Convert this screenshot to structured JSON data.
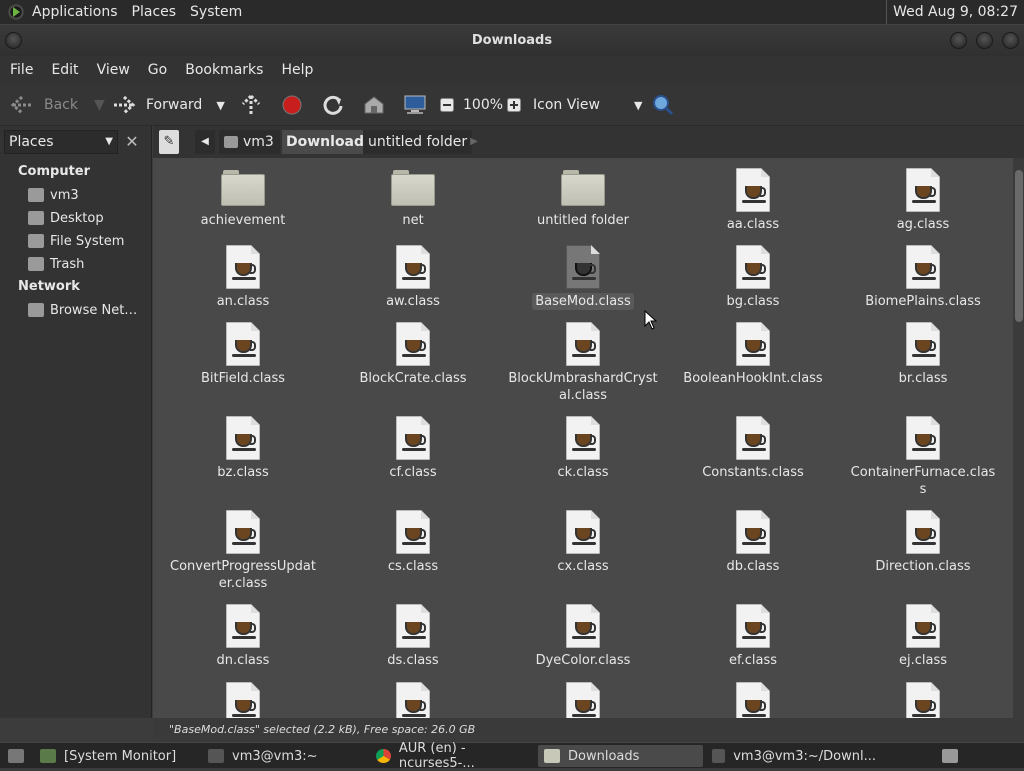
{
  "topbar": {
    "menus": [
      "Applications",
      "Places",
      "System"
    ],
    "clock": "Wed Aug  9, 08:27"
  },
  "window": {
    "title": "Downloads"
  },
  "menubar": [
    "File",
    "Edit",
    "View",
    "Go",
    "Bookmarks",
    "Help"
  ],
  "toolbar": {
    "back": "Back",
    "forward": "Forward",
    "zoom": "100%",
    "view_mode": "Icon View"
  },
  "sidebar": {
    "header": "Places",
    "sections": [
      {
        "title": "Computer",
        "items": [
          "vm3",
          "Desktop",
          "File System",
          "Trash"
        ]
      },
      {
        "title": "Network",
        "items": [
          "Browse Net…"
        ]
      }
    ]
  },
  "pathbar": {
    "crumbs": [
      "vm3",
      "Downloads",
      "untitled folder"
    ]
  },
  "items": [
    {
      "name": "achievement",
      "type": "folder"
    },
    {
      "name": "net",
      "type": "folder"
    },
    {
      "name": "untitled folder",
      "type": "folder"
    },
    {
      "name": "aa.class",
      "type": "file"
    },
    {
      "name": "ag.class",
      "type": "file"
    },
    {
      "name": "an.class",
      "type": "file"
    },
    {
      "name": "aw.class",
      "type": "file"
    },
    {
      "name": "BaseMod.class",
      "type": "file",
      "selected": true
    },
    {
      "name": "bg.class",
      "type": "file"
    },
    {
      "name": "BiomePlains.class",
      "type": "file"
    },
    {
      "name": "BitField.class",
      "type": "file"
    },
    {
      "name": "BlockCrate.class",
      "type": "file"
    },
    {
      "name": "BlockUmbrashardCrystal.class",
      "type": "file"
    },
    {
      "name": "BooleanHookInt.class",
      "type": "file"
    },
    {
      "name": "br.class",
      "type": "file"
    },
    {
      "name": "bz.class",
      "type": "file"
    },
    {
      "name": "cf.class",
      "type": "file"
    },
    {
      "name": "ck.class",
      "type": "file"
    },
    {
      "name": "Constants.class",
      "type": "file"
    },
    {
      "name": "ContainerFurnace.class",
      "type": "file"
    },
    {
      "name": "ConvertProgressUpdater.class",
      "type": "file"
    },
    {
      "name": "cs.class",
      "type": "file"
    },
    {
      "name": "cx.class",
      "type": "file"
    },
    {
      "name": "db.class",
      "type": "file"
    },
    {
      "name": "Direction.class",
      "type": "file"
    },
    {
      "name": "dn.class",
      "type": "file"
    },
    {
      "name": "ds.class",
      "type": "file"
    },
    {
      "name": "DyeColor.class",
      "type": "file"
    },
    {
      "name": "ef.class",
      "type": "file"
    },
    {
      "name": "ej.class",
      "type": "file"
    },
    {
      "name": "",
      "type": "file"
    },
    {
      "name": "",
      "type": "file"
    },
    {
      "name": "",
      "type": "file"
    },
    {
      "name": "",
      "type": "file"
    },
    {
      "name": "",
      "type": "file"
    }
  ],
  "status": "\"BaseMod.class\" selected (2.2 kB), Free space: 26.0 GB",
  "taskbar": [
    "[System Monitor]",
    "vm3@vm3:~",
    "AUR (en) - ncurses5-...",
    "Downloads",
    "vm3@vm3:~/Downl..."
  ]
}
